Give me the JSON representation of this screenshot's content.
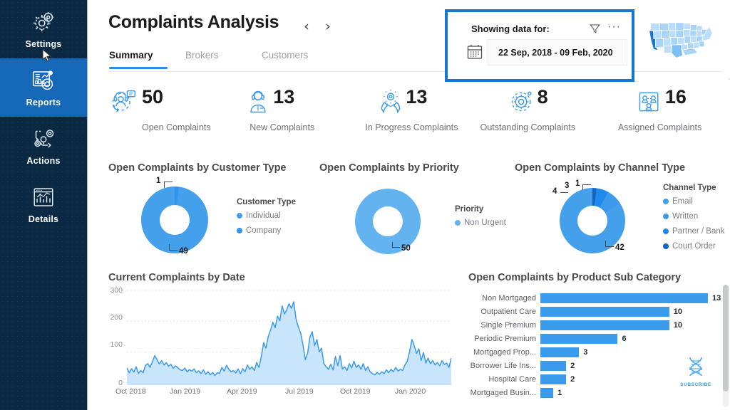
{
  "sidebar": {
    "items": [
      {
        "label": "Settings",
        "icon": "gear-icon",
        "active": false
      },
      {
        "label": "Reports",
        "icon": "report-chart-icon",
        "active": true
      },
      {
        "label": "Actions",
        "icon": "workflow-gear-icon",
        "active": false
      },
      {
        "label": "Details",
        "icon": "dashboard-icon",
        "active": false
      }
    ],
    "bg_color": "#0b2942",
    "active_color": "#1668b8"
  },
  "header": {
    "title": "Complaints Analysis",
    "prev_label": "‹",
    "next_label": "›",
    "tabs": [
      {
        "label": "Summary",
        "active": true
      },
      {
        "label": "Brokers",
        "active": false
      },
      {
        "label": "Customers",
        "active": false
      }
    ]
  },
  "date_filter": {
    "label": "Showing data for:",
    "range": "22 Sep, 2018 - 09 Feb, 2020",
    "more_label": "···",
    "highlight_color": "#1577d4"
  },
  "kpis": [
    {
      "value": "50",
      "label": "Open Complaints",
      "icon": "headset-complaint-icon"
    },
    {
      "value": "13",
      "label": "New Complaints",
      "icon": "agent-icon"
    },
    {
      "value": "13",
      "label": "In Progress Complaints",
      "icon": "hands-gear-icon"
    },
    {
      "value": "8",
      "label": "Outstanding Complaints",
      "icon": "gear-orbit-icon"
    },
    {
      "value": "16",
      "label": "Assigned Complaints",
      "icon": "assign-people-icon"
    }
  ],
  "chart_data": [
    {
      "type": "pie",
      "title": "Open Complaints by Customer Type",
      "legend_title": "Customer Type",
      "legend_position": "right",
      "categories": [
        "Individual",
        "Company"
      ],
      "values": [
        49,
        1
      ],
      "colors": [
        "#45a0ec",
        "#2e93ea"
      ],
      "labels": [
        "49",
        "1"
      ]
    },
    {
      "type": "pie",
      "title": "Open Complaints by Priority",
      "legend_title": "Priority",
      "legend_position": "right",
      "categories": [
        "Non Urgent"
      ],
      "values": [
        50
      ],
      "colors": [
        "#62b3f0"
      ],
      "labels": [
        "50"
      ]
    },
    {
      "type": "pie",
      "title": "Open Complaints by Channel Type",
      "legend_title": "Channel Type",
      "legend_position": "right",
      "categories": [
        "Email",
        "Written",
        "Partner / Bank",
        "Court Order"
      ],
      "values": [
        42,
        4,
        3,
        1
      ],
      "colors": [
        "#45a0ec",
        "#3c9aeb",
        "#1e8aee",
        "#1565c0"
      ],
      "labels": [
        "42",
        "4",
        "3",
        "1"
      ]
    },
    {
      "type": "area",
      "title": "Current Complaints by Date",
      "xlabel": "",
      "ylabel": "",
      "ylim": [
        0,
        300
      ],
      "yticks": [
        "0",
        "100",
        "200",
        "300"
      ],
      "xticks": [
        "Oct 2018",
        "Jan 2019",
        "Apr 2019",
        "Jul 2019",
        "Oct 2019",
        "Jan 2020"
      ],
      "grid": true,
      "line_color": "#3a9bec",
      "fill_color": "#bfe0fa",
      "x": [
        0,
        1,
        2,
        3,
        4,
        5,
        6,
        7,
        8,
        9,
        10,
        11,
        12,
        13,
        14,
        15,
        16,
        17,
        18,
        19,
        20,
        21,
        22,
        23,
        24,
        25,
        26,
        27,
        28,
        29,
        30,
        31,
        32,
        33,
        34,
        35,
        36,
        37,
        38,
        39,
        40,
        41,
        42,
        43,
        44,
        45,
        46,
        47,
        48,
        49,
        50,
        51,
        52,
        53,
        54,
        55,
        56,
        57,
        58,
        59,
        60,
        61,
        62,
        63,
        64,
        65,
        66,
        67,
        68,
        69,
        70,
        71,
        72,
        73,
        74,
        75,
        76,
        77,
        78,
        79,
        80,
        81,
        82,
        83,
        84,
        85,
        86,
        87,
        88,
        89,
        90,
        91,
        92,
        93,
        94,
        95,
        96,
        97,
        98,
        99,
        100,
        101,
        102,
        103,
        104,
        105,
        106,
        107,
        108,
        109,
        110,
        111,
        112,
        113,
        114,
        115,
        116,
        117,
        118,
        119,
        120,
        121,
        122,
        123,
        124,
        125,
        126,
        127,
        128,
        129,
        130,
        131,
        132,
        133,
        134,
        135,
        136,
        137,
        138,
        139,
        140
      ],
      "values": [
        48,
        33,
        46,
        35,
        52,
        31,
        40,
        33,
        56,
        62,
        50,
        68,
        88,
        75,
        61,
        72,
        58,
        65,
        54,
        60,
        47,
        55,
        49,
        42,
        40,
        48,
        36,
        43,
        38,
        45,
        33,
        39,
        30,
        42,
        28,
        36,
        26,
        34,
        24,
        33,
        31,
        50,
        38,
        57,
        44,
        36,
        40,
        32,
        45,
        30,
        46,
        36,
        58,
        44,
        52,
        40,
        66,
        50,
        85,
        130,
        112,
        150,
        170,
        195,
        178,
        215,
        200,
        248,
        222,
        236,
        255,
        240,
        261,
        205,
        180,
        160,
        122,
        75,
        96,
        148,
        165,
        120,
        140,
        100,
        112,
        62,
        52,
        44,
        60,
        42,
        85,
        55,
        88,
        45,
        52,
        40,
        62,
        48,
        70,
        50,
        58,
        44,
        62,
        40,
        52,
        36,
        30,
        26,
        34,
        28,
        36,
        30,
        42,
        33,
        44,
        36,
        50,
        38,
        44,
        40,
        58,
        70,
        100,
        140,
        120,
        95,
        110,
        72,
        98,
        64,
        80,
        62,
        72,
        58,
        66,
        55,
        72,
        60,
        64,
        50,
        80
      ]
    },
    {
      "type": "bar",
      "orientation": "horizontal",
      "title": "Open Complaints by Product Sub Category",
      "categories": [
        "Non Mortgaged",
        "Outpatient Care",
        "Single Premium",
        "Periodic Premium",
        "Mortgaged Prop...",
        "Borrower Life Ins...",
        "Hospital Care",
        "Mortgaged Busin..."
      ],
      "values": [
        13,
        10,
        10,
        6,
        3,
        2,
        2,
        1
      ],
      "bar_color": "#3a9bec",
      "xlim": [
        0,
        13
      ]
    }
  ],
  "watermark": {
    "text": "SUBSCRIBE",
    "icon": "dna-icon"
  }
}
